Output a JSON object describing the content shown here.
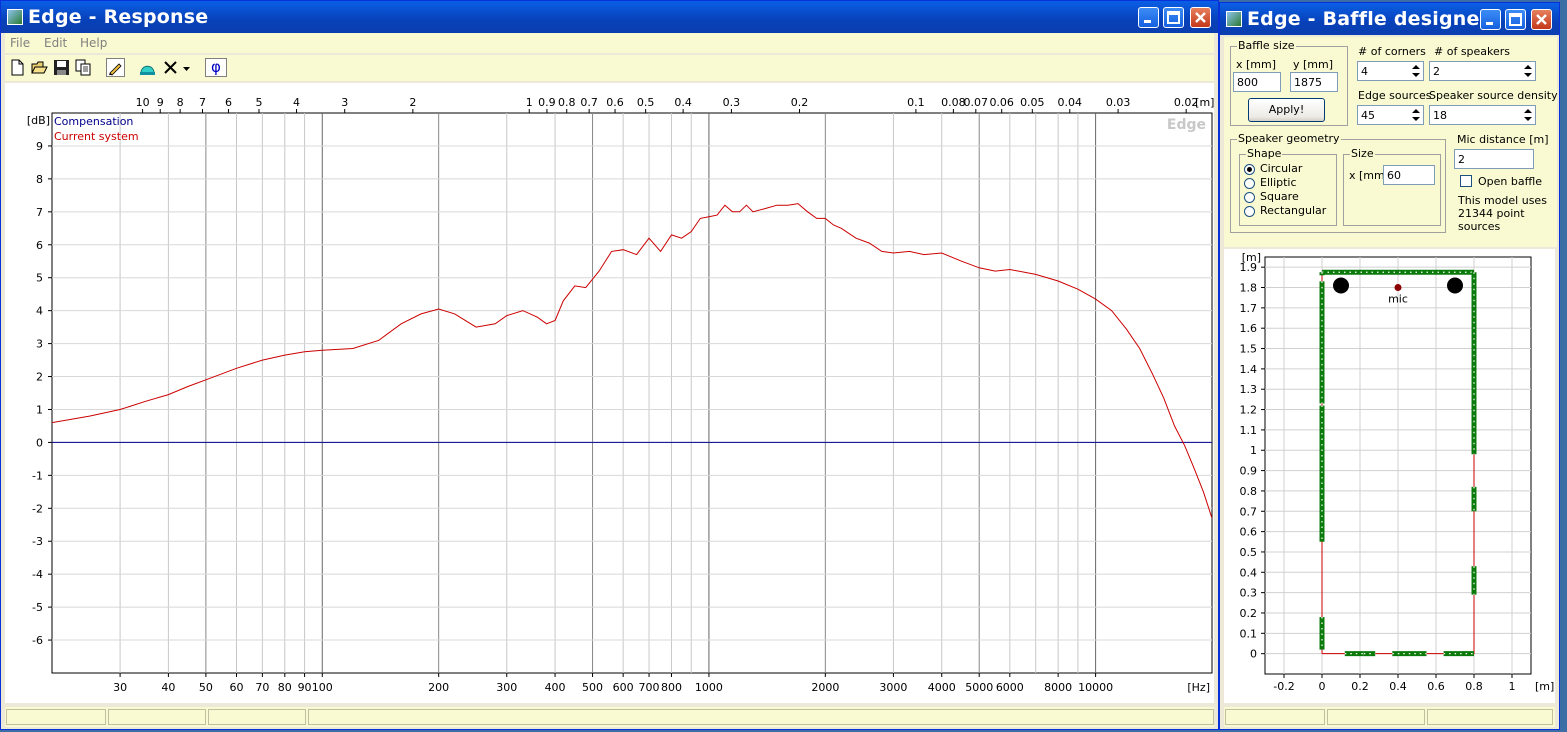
{
  "response_window": {
    "title": "Edge - Response",
    "menu": [
      "File",
      "Edit",
      "Help"
    ],
    "toolbar_icons": [
      "new-file-icon",
      "open-folder-icon",
      "save-disk-icon",
      "copy-icon",
      "pencil-icon",
      "speaker-icon",
      "delete-x-icon",
      "dropdown-arrow-icon",
      "phase-phi-icon"
    ],
    "phase_label": "φ",
    "watermark": "Edge"
  },
  "baffle_window": {
    "title": "Edge - Baffle designer",
    "baffle_size": {
      "caption": "Baffle size",
      "x_label": "x [mm]",
      "y_label": "y [mm]",
      "x_value": "800",
      "y_value": "1875",
      "apply_label": "Apply!"
    },
    "corners": {
      "label": "# of corners",
      "value": "4"
    },
    "speakers": {
      "label": "# of speakers",
      "value": "2"
    },
    "edge_sources": {
      "label": "Edge sources",
      "value": "45"
    },
    "speaker_density": {
      "label": "Speaker source density",
      "value": "18"
    },
    "speaker_geometry": {
      "caption": "Speaker geometry",
      "shape_caption": "Shape",
      "shapes": [
        "Circular",
        "Elliptic",
        "Square",
        "Rectangular"
      ],
      "selected_shape": "Circular",
      "size_caption": "Size",
      "size_label": "x [mm]",
      "size_value": "60"
    },
    "mic_distance": {
      "label": "Mic distance [m]",
      "value": "2"
    },
    "open_baffle": {
      "label": "Open baffle",
      "checked": false
    },
    "model_info": [
      "This model uses",
      "21344 point",
      "sources"
    ],
    "mic_label": "mic"
  },
  "chart_data": [
    {
      "type": "line",
      "title": "",
      "xlabel": "[Hz]",
      "ylabel": "[dB]",
      "x_scale": "log",
      "xlim": [
        20,
        20000
      ],
      "ylim": [
        -7,
        10
      ],
      "grid": true,
      "legend_position": "top-left",
      "x_tick_labels": [
        30,
        40,
        50,
        60,
        70,
        80,
        90,
        100,
        200,
        300,
        400,
        500,
        600,
        700,
        800,
        1000,
        2000,
        3000,
        4000,
        5000,
        6000,
        8000,
        10000
      ],
      "top_axis_unit": "[m]",
      "top_axis_labels": [
        {
          "label": "10",
          "hz": 34.3
        },
        {
          "label": "9",
          "hz": 38.1
        },
        {
          "label": "8",
          "hz": 42.9
        },
        {
          "label": "7",
          "hz": 49
        },
        {
          "label": "6",
          "hz": 57.2
        },
        {
          "label": "5",
          "hz": 68.6
        },
        {
          "label": "4",
          "hz": 85.8
        },
        {
          "label": "3",
          "hz": 114.3
        },
        {
          "label": "2",
          "hz": 171.5
        },
        {
          "label": "1",
          "hz": 343
        },
        {
          "label": "0.9",
          "hz": 381.1
        },
        {
          "label": "0.8",
          "hz": 428.8
        },
        {
          "label": "0.7",
          "hz": 490
        },
        {
          "label": "0.6",
          "hz": 571.7
        },
        {
          "label": "0.5",
          "hz": 686
        },
        {
          "label": "0.4",
          "hz": 857.5
        },
        {
          "label": "0.3",
          "hz": 1143.3
        },
        {
          "label": "0.2",
          "hz": 1715
        },
        {
          "label": "0.1",
          "hz": 3430
        },
        {
          "label": "0.08",
          "hz": 4287.5
        },
        {
          "label": "0.07",
          "hz": 4900
        },
        {
          "label": "0.06",
          "hz": 5716.7
        },
        {
          "label": "0.05",
          "hz": 6860
        },
        {
          "label": "0.04",
          "hz": 8575
        },
        {
          "label": "0.03",
          "hz": 11433.3
        },
        {
          "label": "0.02",
          "hz": 17150
        }
      ],
      "y_tick_labels": [
        "9",
        "8",
        "7",
        "6",
        "5",
        "4",
        "3",
        "2",
        "1",
        "0",
        "-1",
        "-2",
        "-3",
        "-4",
        "-5",
        "-6"
      ],
      "series": [
        {
          "name": "Compensation",
          "color": "#00008b",
          "x": [
            20,
            20000
          ],
          "y": [
            0,
            0
          ]
        },
        {
          "name": "Current system",
          "color": "#cc0000",
          "x": [
            20,
            25,
            30,
            35,
            40,
            45,
            50,
            60,
            70,
            80,
            90,
            100,
            120,
            140,
            160,
            180,
            200,
            220,
            250,
            280,
            300,
            330,
            360,
            380,
            400,
            420,
            450,
            480,
            520,
            560,
            600,
            650,
            700,
            750,
            800,
            850,
            900,
            950,
            1000,
            1050,
            1100,
            1150,
            1200,
            1250,
            1300,
            1400,
            1500,
            1600,
            1700,
            1800,
            1900,
            2000,
            2100,
            2200,
            2400,
            2600,
            2800,
            3000,
            3300,
            3600,
            4000,
            4500,
            5000,
            5500,
            6000,
            7000,
            8000,
            9000,
            10000,
            11000,
            12000,
            13000,
            14000,
            15000,
            16000,
            17000,
            18000,
            19000,
            20000
          ],
          "y": [
            0.6,
            0.8,
            1.0,
            1.25,
            1.45,
            1.7,
            1.9,
            2.25,
            2.5,
            2.65,
            2.75,
            2.8,
            2.85,
            3.1,
            3.6,
            3.9,
            4.05,
            3.9,
            3.5,
            3.6,
            3.85,
            4.0,
            3.8,
            3.6,
            3.7,
            4.3,
            4.75,
            4.7,
            5.2,
            5.8,
            5.85,
            5.7,
            6.2,
            5.8,
            6.3,
            6.2,
            6.4,
            6.8,
            6.85,
            6.9,
            7.2,
            7.0,
            7.0,
            7.2,
            7.0,
            7.1,
            7.2,
            7.2,
            7.25,
            7.0,
            6.8,
            6.8,
            6.6,
            6.5,
            6.2,
            6.05,
            5.8,
            5.75,
            5.8,
            5.7,
            5.75,
            5.5,
            5.3,
            5.2,
            5.25,
            5.1,
            4.9,
            4.65,
            4.35,
            4.0,
            3.45,
            2.85,
            2.1,
            1.35,
            0.5,
            -0.1,
            -0.8,
            -1.5,
            -2.3
          ]
        }
      ]
    },
    {
      "type": "scatter",
      "title": "",
      "xlabel": "[m]",
      "ylabel": "[m]",
      "xlim": [
        -0.3,
        1.1
      ],
      "ylim": [
        -0.1,
        1.95
      ],
      "grid": true,
      "x_tick_labels": [
        "-0.2",
        "0",
        "0.2",
        "0.4",
        "0.6",
        "0.8",
        "1"
      ],
      "y_tick_labels": [
        "1.9",
        "1.8",
        "1.7",
        "1.6",
        "1.5",
        "1.4",
        "1.3",
        "1.2",
        "1.1",
        "1",
        "0.9",
        "0.8",
        "0.7",
        "0.6",
        "0.5",
        "0.4",
        "0.3",
        "0.2",
        "0.1",
        "0"
      ],
      "baffle_outline": {
        "x": [
          0,
          0.8,
          0.8,
          0,
          0
        ],
        "y": [
          0,
          0,
          1.875,
          1.875,
          0
        ],
        "color": "#cc0000"
      },
      "speakers": {
        "x": [
          0.1,
          0.7
        ],
        "y": [
          1.81,
          1.81
        ]
      },
      "mic": {
        "x": 0.4,
        "y": 1.8
      },
      "edge_segments": [
        {
          "x1": 0,
          "y1": 1.875,
          "x2": 0.8,
          "y2": 1.875
        },
        {
          "x1": 0,
          "y1": 1.875,
          "x2": 0,
          "y2": 1.86
        },
        {
          "x1": 0,
          "y1": 1.83,
          "x2": 0,
          "y2": 1.23
        },
        {
          "x1": 0,
          "y1": 1.22,
          "x2": 0,
          "y2": 0.55
        },
        {
          "x1": 0,
          "y1": 0.18,
          "x2": 0,
          "y2": 0.02
        },
        {
          "x1": 0.8,
          "y1": 1.875,
          "x2": 0.8,
          "y2": 0.98
        },
        {
          "x1": 0.8,
          "y1": 0.82,
          "x2": 0.8,
          "y2": 0.7
        },
        {
          "x1": 0.8,
          "y1": 0.43,
          "x2": 0.8,
          "y2": 0.29
        },
        {
          "x1": 0.12,
          "y1": 0,
          "x2": 0.22,
          "y2": 0
        },
        {
          "x1": 0.22,
          "y1": 0,
          "x2": 0.28,
          "y2": 0
        },
        {
          "x1": 0.37,
          "y1": 0,
          "x2": 0.55,
          "y2": 0
        },
        {
          "x1": 0.64,
          "y1": 0,
          "x2": 0.8,
          "y2": 0
        }
      ]
    }
  ]
}
